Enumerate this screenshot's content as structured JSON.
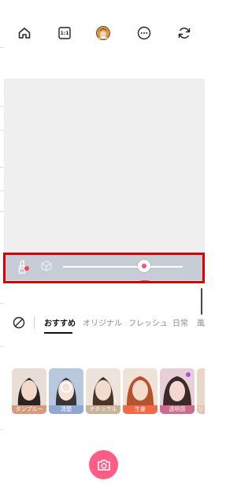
{
  "toolbar": {
    "home_icon": "home-icon",
    "aspect_label": "1:1",
    "effect_icon": "beauty-effect-icon",
    "more_icon": "more-icon",
    "flip_icon": "flip-camera-icon"
  },
  "slider": {
    "value": 0.68,
    "left_icon": "lipstick-icon",
    "right_icon": "cube-icon",
    "accent_color": "#ff4f7b"
  },
  "category_tabs": {
    "none_icon": "no-filter-icon",
    "items": [
      {
        "label": "おすすめ",
        "active": true
      },
      {
        "label": "オリジナル",
        "active": false
      },
      {
        "label": "フレッシュ",
        "active": false
      },
      {
        "label": "日常",
        "active": false
      },
      {
        "label": "風",
        "active": false
      }
    ]
  },
  "filters": [
    {
      "label": "タンプルー",
      "label_color": "#d99a7c"
    },
    {
      "label": "清楚",
      "label_color": "#8fa9d3"
    },
    {
      "label": "ナチュラル",
      "label_color": "#c9b39b"
    },
    {
      "label": "生姜",
      "label_color": "#f26a44"
    },
    {
      "label": "透明感",
      "label_color": "#d06a8a"
    },
    {
      "label": "ソ",
      "label_color": "#e1c7b0"
    }
  ],
  "shutter": {
    "icon": "camera-icon",
    "color": "#ff5c86"
  }
}
